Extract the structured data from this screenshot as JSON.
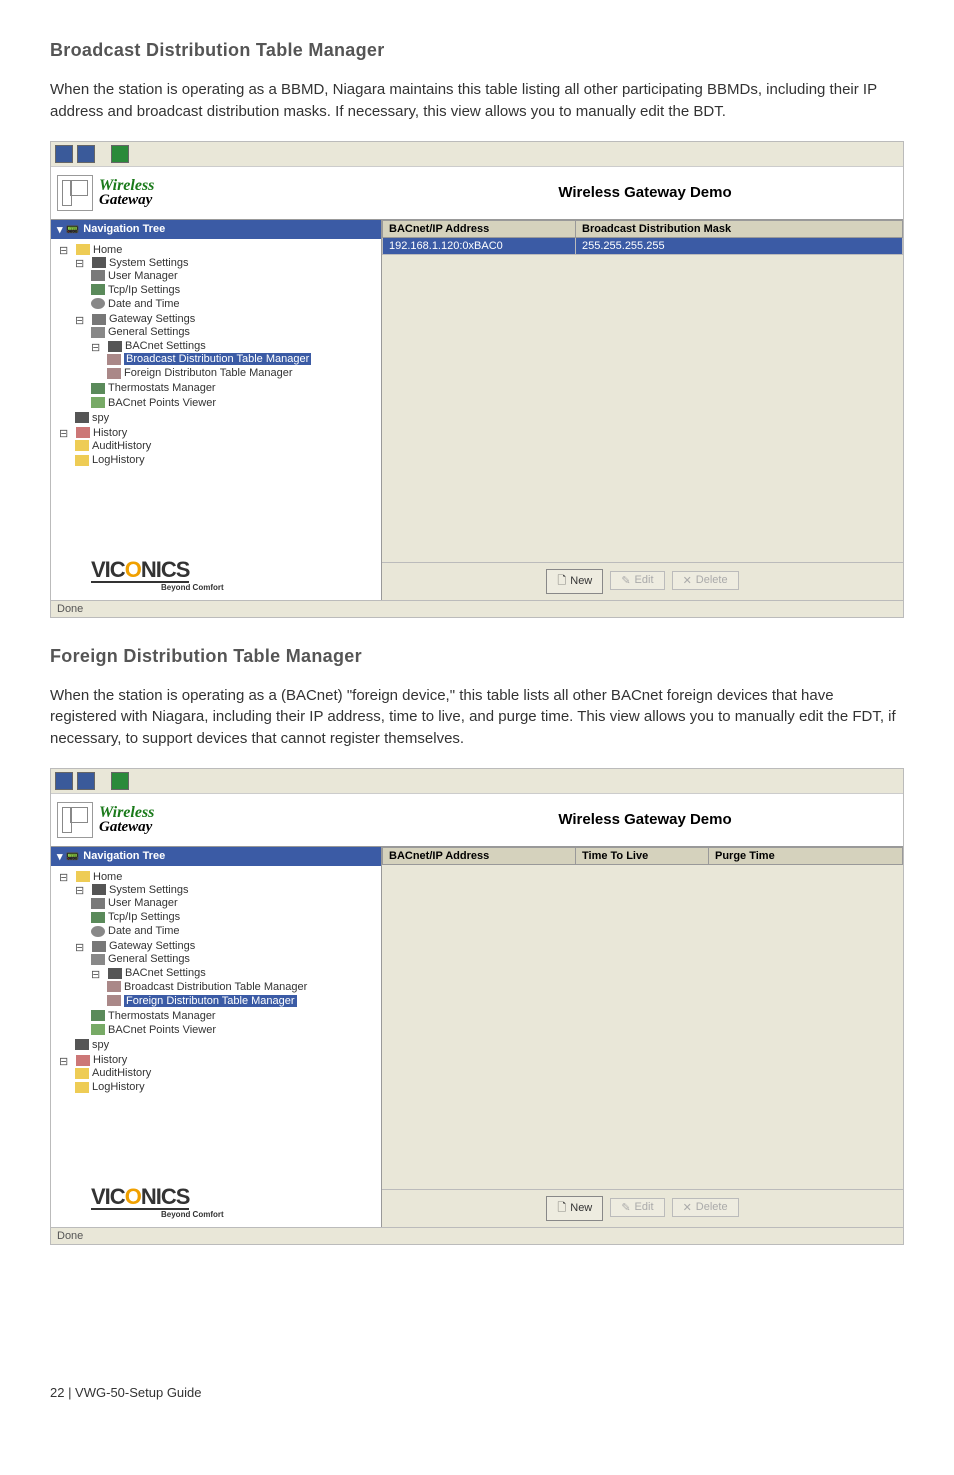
{
  "section1": {
    "title": "Broadcast Distribution Table Manager",
    "paragraph": "When the station is operating as a BBMD, Niagara maintains this table listing all other participating BBMDs, including their IP address and broadcast distribution masks. If necessary, this view allows you to manually edit the BDT."
  },
  "section2": {
    "title": "Foreign Distribution Table Manager",
    "paragraph": "When the station is operating as a (BACnet) \"foreign device,\" this table lists all other BACnet foreign devices that have registered with Niagara, including their IP address, time to live, and purge time. This view allows you to manually edit the FDT, if necessary, to support devices that cannot register themselves."
  },
  "common": {
    "logo_top": "Wireless",
    "logo_bottom": "Gateway",
    "header_title": "Wireless Gateway Demo",
    "nav_header": "Navigation Tree",
    "status": "Done",
    "viconics": "VIC",
    "viconics_o": "O",
    "viconics_rest": "NICS",
    "viconics_tag": "Beyond Comfort",
    "btn_new": "New",
    "btn_edit": "Edit",
    "btn_delete": "Delete"
  },
  "tree": {
    "home": "Home",
    "sys": "System Settings",
    "user": "User Manager",
    "tcp": "Tcp/Ip Settings",
    "date": "Date and Time",
    "gate": "Gateway Settings",
    "gen": "General Settings",
    "bac": "BACnet Settings",
    "bdt": "Broadcast Distribution Table Manager",
    "fdt": "Foreign Distributon Table Manager",
    "therm": "Thermostats Manager",
    "points": "BACnet Points Viewer",
    "spy": "spy",
    "hist": "History",
    "audit": "AuditHistory",
    "log": "LogHistory"
  },
  "grid1": {
    "col1": "BACnet/IP Address",
    "col2": "Broadcast Distribution Mask",
    "rows": [
      {
        "addr": "192.168.1.120:0xBAC0",
        "mask": "255.255.255.255"
      }
    ]
  },
  "grid2": {
    "col1": "BACnet/IP Address",
    "col2": "Time To Live",
    "col3": "Purge Time"
  },
  "footer": "22 | VWG-50-Setup Guide"
}
